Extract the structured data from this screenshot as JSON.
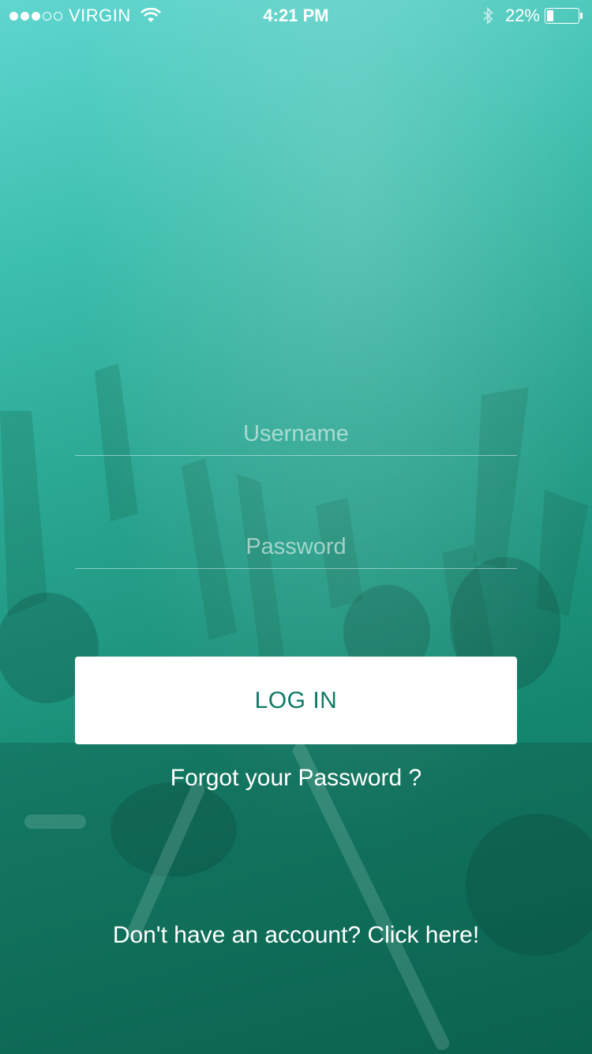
{
  "status_bar": {
    "signal_dots_filled": 3,
    "signal_dots_total": 5,
    "carrier": "VIRGIN",
    "time": "4:21 PM",
    "battery_percent": "22%",
    "battery_level": 0.22,
    "icons": [
      "wifi-icon",
      "bluetooth-icon",
      "battery-icon"
    ]
  },
  "login_form": {
    "username_placeholder": "Username",
    "password_placeholder": "Password",
    "login_label": "LOG IN",
    "forgot_label": "Forgot your Password ?",
    "signup_label": "Don't have an account? Click here!"
  },
  "colors": {
    "gradient_top": "#5fd6cf",
    "gradient_bottom": "#0b6e58",
    "button_text": "#0e7a66"
  }
}
